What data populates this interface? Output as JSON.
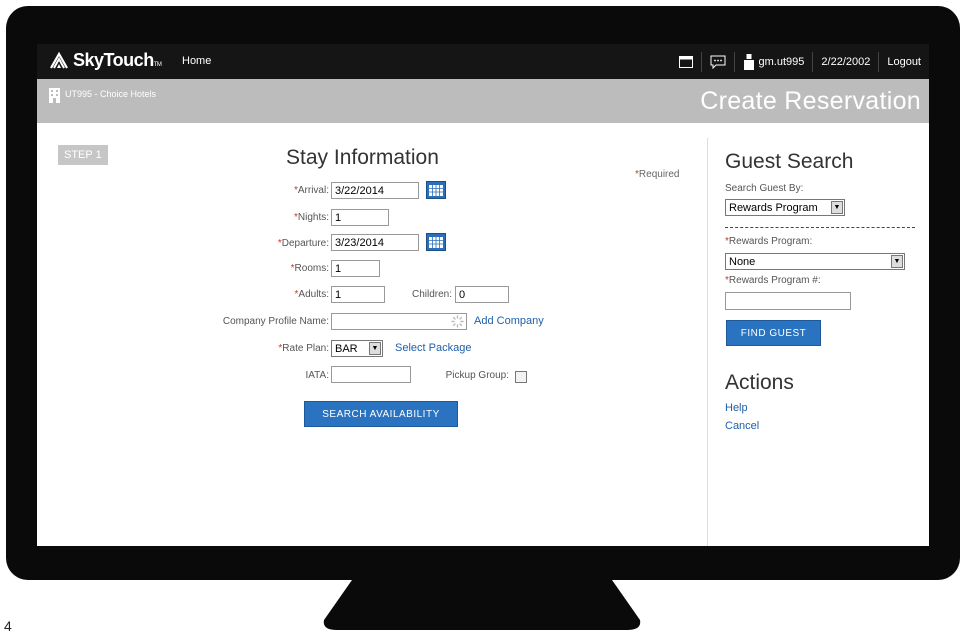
{
  "app": {
    "logo_text": "SkyTouch",
    "logo_tm": "TM",
    "nav_home": "Home",
    "user": "gm.ut995",
    "date": "2/22/2002",
    "logout": "Logout",
    "hotel": "UT995 - Choice Hotels",
    "page_title": "Create Reservation"
  },
  "step": "STEP 1",
  "stay": {
    "title": "Stay Information",
    "required_note": "Required",
    "arrival_label": "Arrival:",
    "arrival_value": "3/22/2014",
    "nights_label": "Nights:",
    "nights_value": "1",
    "departure_label": "Departure:",
    "departure_value": "3/23/2014",
    "rooms_label": "Rooms:",
    "rooms_value": "1",
    "adults_label": "Adults:",
    "adults_value": "1",
    "children_label": "Children:",
    "children_value": "0",
    "company_label": "Company Profile Name:",
    "company_value": "",
    "add_company": "Add Company",
    "rate_plan_label": "Rate Plan:",
    "rate_plan_value": "BAR",
    "select_package": "Select Package",
    "iata_label": "IATA:",
    "iata_value": "",
    "pickup_label": "Pickup Group:",
    "search_button": "SEARCH AVAILABILITY"
  },
  "guest_search": {
    "title": "Guest Search",
    "search_by_label": "Search Guest By:",
    "search_by_value": "Rewards Program",
    "rewards_program_label": "Rewards Program:",
    "rewards_program_value": "None",
    "rewards_number_label": "Rewards Program #:",
    "rewards_number_value": "",
    "find_button": "FIND GUEST"
  },
  "actions": {
    "title": "Actions",
    "help": "Help",
    "cancel": "Cancel"
  },
  "page_number": "4",
  "colors": {
    "accent": "#2a73c0",
    "link": "#1f5fa9",
    "required": "#c0392b",
    "topbar": "#151515",
    "subbar": "#bcbcbc"
  }
}
